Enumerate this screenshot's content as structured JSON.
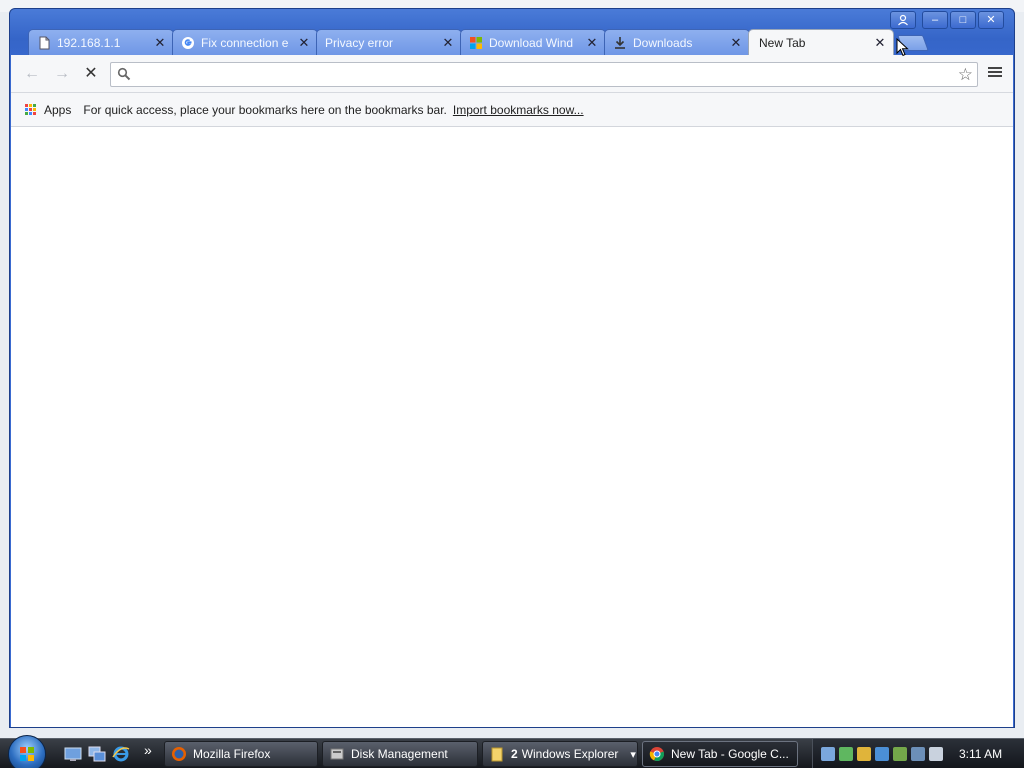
{
  "window": {
    "controls": {
      "profile": "●",
      "minimize": "–",
      "maximize": "□",
      "close": "✕"
    }
  },
  "tabs": [
    {
      "label": "192.168.1.1",
      "icon": "page-icon",
      "close": "✕"
    },
    {
      "label": "Fix connection e",
      "icon": "google-icon",
      "close": "✕"
    },
    {
      "label": "Privacy error",
      "icon": "none",
      "close": "✕"
    },
    {
      "label": "Download Wind",
      "icon": "windows-icon",
      "close": "✕"
    },
    {
      "label": "Downloads",
      "icon": "download-icon",
      "close": "✕"
    },
    {
      "label": "New Tab",
      "icon": "none",
      "close": "✕",
      "active": true
    }
  ],
  "toolbar": {
    "back": "←",
    "forward": "→",
    "stop": "✕",
    "omnibox": {
      "value": "",
      "placeholder": ""
    },
    "star": "☆"
  },
  "bookmarks": {
    "apps_label": "Apps",
    "message": "For quick access, place your bookmarks here on the bookmarks bar.",
    "import_link": "Import bookmarks now..."
  },
  "taskbar": {
    "items": [
      {
        "label": "Mozilla Firefox",
        "icon": "firefox-icon"
      },
      {
        "label": "Disk Management",
        "icon": "disk-management-icon"
      },
      {
        "count": "2",
        "label": "Windows Explorer",
        "icon": "folder-icon",
        "dropdown": "▾"
      },
      {
        "label": "New Tab - Google C...",
        "icon": "chrome-icon",
        "active": true
      }
    ],
    "overflow": "»",
    "clock": "3:11 AM"
  },
  "colors": {
    "title_blue": "#3a6ad0",
    "tab_inactive": "#7aa0e8",
    "tab_active": "#f6f7f9",
    "page_bg": "#ffffff"
  }
}
